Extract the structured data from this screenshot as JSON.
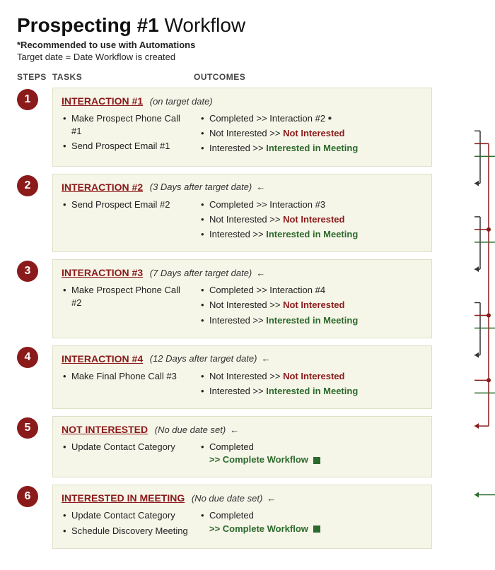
{
  "header": {
    "title_bold": "Prospecting #1",
    "title_light": " Workflow",
    "subtitle_bold": "*Recommended to use with Automations",
    "subtitle_regular": "Target date = Date Workflow is created"
  },
  "columns": {
    "steps": "STEPS",
    "tasks": "TASKS",
    "outcomes": "OUTCOMES"
  },
  "steps": [
    {
      "id": 1,
      "heading": "INTERACTION #1",
      "timing": "(on target date)",
      "tasks": [
        "Make Prospect Phone Call #1",
        "Send Prospect Email #1"
      ],
      "outcomes": [
        {
          "type": "completed",
          "text": "Completed >> Interaction #2"
        },
        {
          "type": "not-interested",
          "text": "Not Interested >> Not Interested"
        },
        {
          "type": "interested",
          "text": "Interested >> Interested in Meeting"
        }
      ]
    },
    {
      "id": 2,
      "heading": "INTERACTION #2",
      "timing": "(3 Days after target date)",
      "has_arrow_in": true,
      "tasks": [
        "Send Prospect Email #2"
      ],
      "outcomes": [
        {
          "type": "completed",
          "text": "Completed >> Interaction #3"
        },
        {
          "type": "not-interested",
          "text": "Not Interested >> Not Interested"
        },
        {
          "type": "interested",
          "text": "Interested >> Interested in Meeting"
        }
      ]
    },
    {
      "id": 3,
      "heading": "INTERACTION #3",
      "timing": "(7 Days after target date)",
      "has_arrow_in": true,
      "tasks": [
        "Make Prospect Phone Call #2"
      ],
      "outcomes": [
        {
          "type": "completed",
          "text": "Completed >> Interaction #4"
        },
        {
          "type": "not-interested",
          "text": "Not Interested >> Not Interested"
        },
        {
          "type": "interested",
          "text": "Interested >> Interested in Meeting"
        }
      ]
    },
    {
      "id": 4,
      "heading": "INTERACTION #4",
      "timing": "(12 Days after target date)",
      "has_arrow_in": true,
      "tasks": [
        "Make Final Phone Call #3"
      ],
      "outcomes": [
        {
          "type": "not-interested",
          "text": "Not Interested >> Not Interested"
        },
        {
          "type": "interested",
          "text": "Interested >> Interested in Meeting"
        }
      ]
    },
    {
      "id": 5,
      "heading": "NOT INTERESTED",
      "timing": "(No due date set)",
      "has_arrow_in": true,
      "tasks": [
        "Update Contact Category"
      ],
      "outcomes": [
        {
          "type": "completed-workflow",
          "text": "Completed",
          "workflow_text": ">> Complete Workflow"
        }
      ]
    },
    {
      "id": 6,
      "heading": "INTERESTED IN MEETING",
      "timing": "(No due date set)",
      "has_arrow_in": true,
      "tasks": [
        "Update Contact Category",
        "Schedule Discovery Meeting"
      ],
      "outcomes": [
        {
          "type": "completed-workflow",
          "text": "Completed",
          "workflow_text": ">> Complete Workflow"
        }
      ]
    }
  ],
  "colors": {
    "red": "#8B1A1A",
    "green": "#2d6a2d",
    "dark": "#222",
    "bg": "#f5f5e8"
  }
}
